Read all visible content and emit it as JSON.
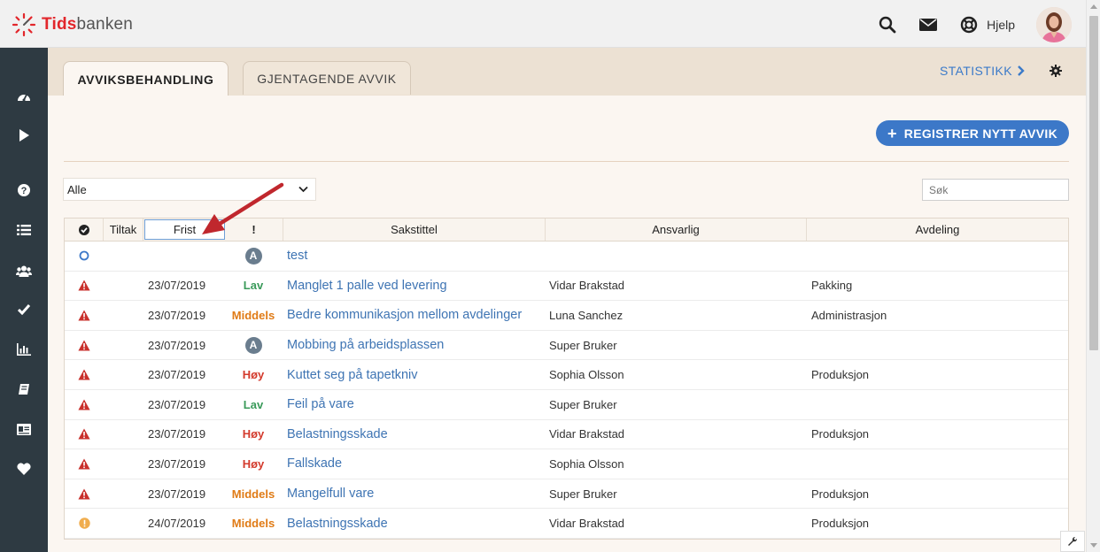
{
  "app": {
    "logo_part1": "Tids",
    "logo_part2": "banken",
    "help_label": "Hjelp"
  },
  "tabs": [
    {
      "label": "AVVIKSBEHANDLING",
      "active": true
    },
    {
      "label": "GJENTAGENDE AVVIK",
      "active": false
    }
  ],
  "statistics_label": "STATISTIKK",
  "register_button_label": "REGISTRER NYTT AVVIK",
  "filter": {
    "selected": "Alle"
  },
  "search": {
    "placeholder": "Søk"
  },
  "table": {
    "headers": {
      "tiltak": "Tiltak",
      "frist": "Frist",
      "prio": "!",
      "title": "Sakstittel",
      "responsible": "Ansvarlig",
      "department": "Avdeling"
    },
    "rows": [
      {
        "status": "circle-open-icon",
        "date": "",
        "priority": "A",
        "priority_type": "badge",
        "title": "test",
        "responsible": "",
        "department": ""
      },
      {
        "status": "warning-red-icon",
        "date": "23/07/2019",
        "priority": "Lav",
        "priority_type": "low",
        "title": "Manglet 1 palle ved levering",
        "responsible": "Vidar Brakstad",
        "department": "Pakking"
      },
      {
        "status": "warning-red-icon",
        "date": "23/07/2019",
        "priority": "Middels",
        "priority_type": "medium",
        "title": "Bedre kommunikasjon mellom avdelinger",
        "responsible": "Luna Sanchez",
        "department": "Administrasjon"
      },
      {
        "status": "warning-red-icon",
        "date": "23/07/2019",
        "priority": "A",
        "priority_type": "badge",
        "title": "Mobbing på arbeidsplassen",
        "responsible": "Super Bruker",
        "department": ""
      },
      {
        "status": "warning-red-icon",
        "date": "23/07/2019",
        "priority": "Høy",
        "priority_type": "high",
        "title": "Kuttet seg på tapetkniv",
        "responsible": "Sophia Olsson",
        "department": "Produksjon"
      },
      {
        "status": "warning-red-icon",
        "date": "23/07/2019",
        "priority": "Lav",
        "priority_type": "low",
        "title": "Feil på vare",
        "responsible": "Super Bruker",
        "department": ""
      },
      {
        "status": "warning-red-icon",
        "date": "23/07/2019",
        "priority": "Høy",
        "priority_type": "high",
        "title": "Belastningsskade",
        "responsible": "Vidar Brakstad",
        "department": "Produksjon"
      },
      {
        "status": "warning-red-icon",
        "date": "23/07/2019",
        "priority": "Høy",
        "priority_type": "high",
        "title": "Fallskade",
        "responsible": "Sophia Olsson",
        "department": ""
      },
      {
        "status": "warning-red-icon",
        "date": "23/07/2019",
        "priority": "Middels",
        "priority_type": "medium",
        "title": "Mangelfull vare",
        "responsible": "Super Bruker",
        "department": "Produksjon"
      },
      {
        "status": "info-orange-icon",
        "date": "24/07/2019",
        "priority": "Middels",
        "priority_type": "medium",
        "title": "Belastningsskade",
        "responsible": "Vidar Brakstad",
        "department": "Produksjon"
      }
    ]
  },
  "colors": {
    "accent": "#3c78c8",
    "sidebar": "#2e3a42",
    "prio_low": "#3a9a5a",
    "prio_medium": "#e07b16",
    "prio_high": "#d33a2c",
    "warning": "#c9302c",
    "annotation_arrow": "#c0272d"
  },
  "sidebar_icons": [
    "dashboard-icon",
    "play-icon",
    "help-icon",
    "list-icon",
    "users-icon",
    "check-icon",
    "chart-icon",
    "book-icon",
    "id-card-icon",
    "heart-icon"
  ]
}
